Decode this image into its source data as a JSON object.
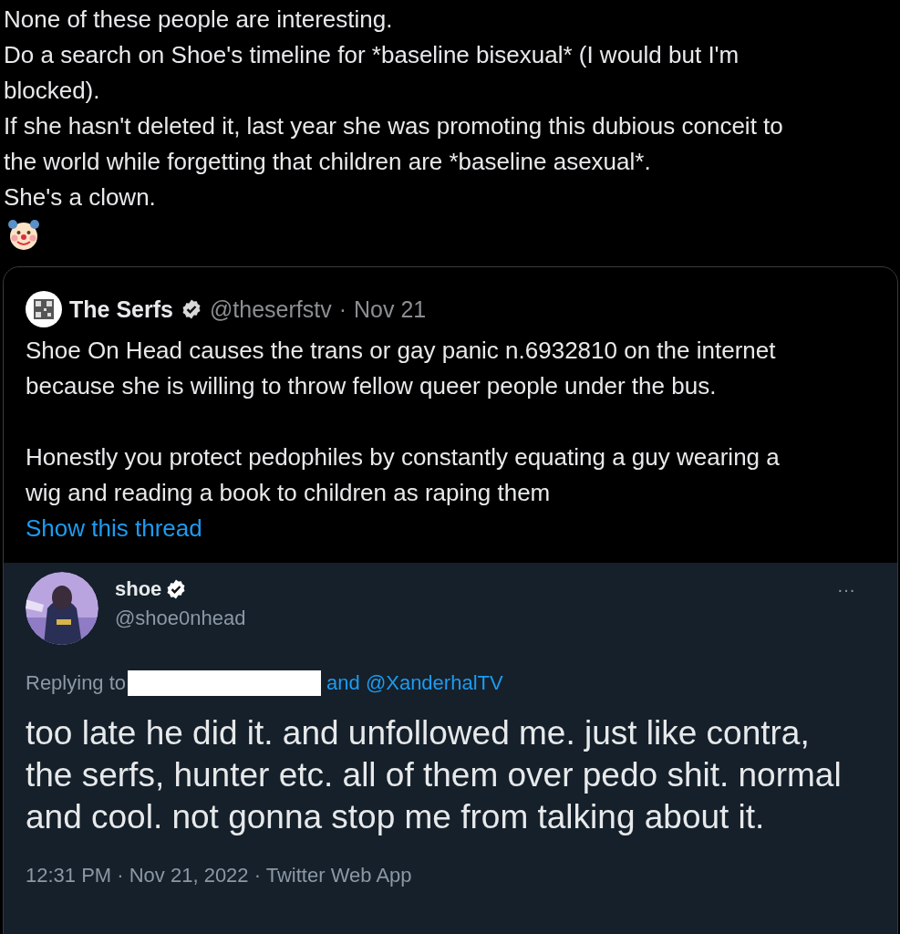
{
  "post": {
    "paragraphs": [
      "None of these people are interesting.",
      "Do a search on Shoe's timeline for *baseline bisexual* (I would but I'm blocked).",
      "If she hasn't deleted it, last year she was promoting this dubious conceit to the world while forgetting that children are *baseline asexual*.",
      "She's a clown."
    ]
  },
  "quote": {
    "name": "The Serfs",
    "verified": true,
    "handle": "@theserfstv",
    "separator": "·",
    "date": "Nov 21",
    "paragraphs": [
      "Shoe On Head causes the trans or gay panic n.6932810 on the internet because she is willing to throw fellow queer people under the bus.",
      "Honestly you protect pedophiles by constantly equating a guy wearing a wig and reading a book to children as raping them"
    ],
    "show_thread": "Show this thread"
  },
  "embedded_tweet": {
    "name": "shoe",
    "verified": true,
    "handle": "@shoe0nhead",
    "more": "···",
    "replying_label": "Replying to",
    "replying_rest": "and @XanderhalTV",
    "text": "too late he did it. and unfollowed me. just like contra, the serfs, hunter etc. all of them over pedo shit. normal and cool. not gonna stop me from talking about it.",
    "meta": "12:31 PM · Nov 21, 2022 · Twitter Web App"
  }
}
